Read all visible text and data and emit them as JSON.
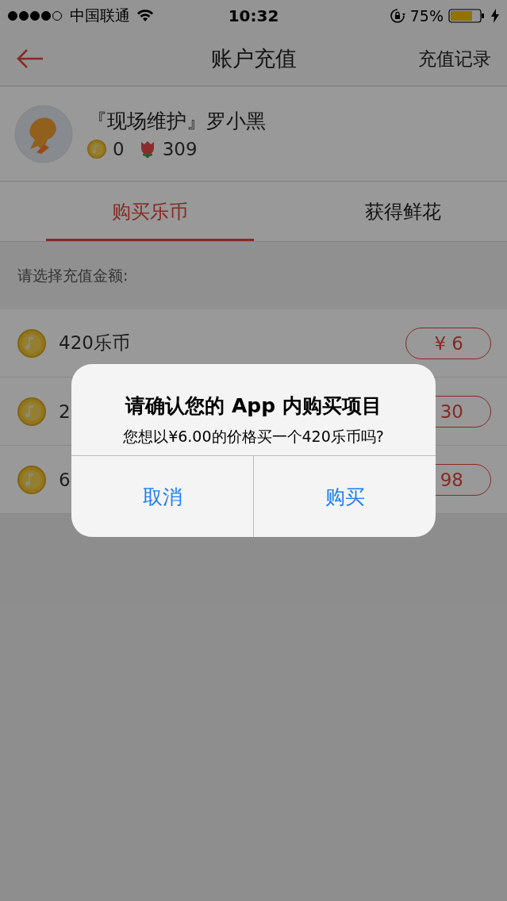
{
  "status_bar": {
    "carrier": "中国联通",
    "time": "10:32",
    "battery": "75%"
  },
  "nav": {
    "title": "账户充值",
    "action": "充值记录"
  },
  "profile": {
    "name": "『现场维护』罗小黑",
    "coins": "0",
    "flowers": "309"
  },
  "tabs": [
    {
      "label": "购买乐币",
      "selected": true
    },
    {
      "label": "获得鲜花",
      "selected": false
    }
  ],
  "section_label": "请选择充值金额:",
  "packages": [
    {
      "name": "420乐币",
      "price": "¥ 6"
    },
    {
      "name": "2",
      "price": "30"
    },
    {
      "name": "6",
      "price": "98"
    }
  ],
  "dialog": {
    "title": "请确认您的 App 内购买项目",
    "message": "您想以¥6.00的价格买一个420乐币吗?",
    "buttons": [
      "取消",
      "购买"
    ]
  }
}
